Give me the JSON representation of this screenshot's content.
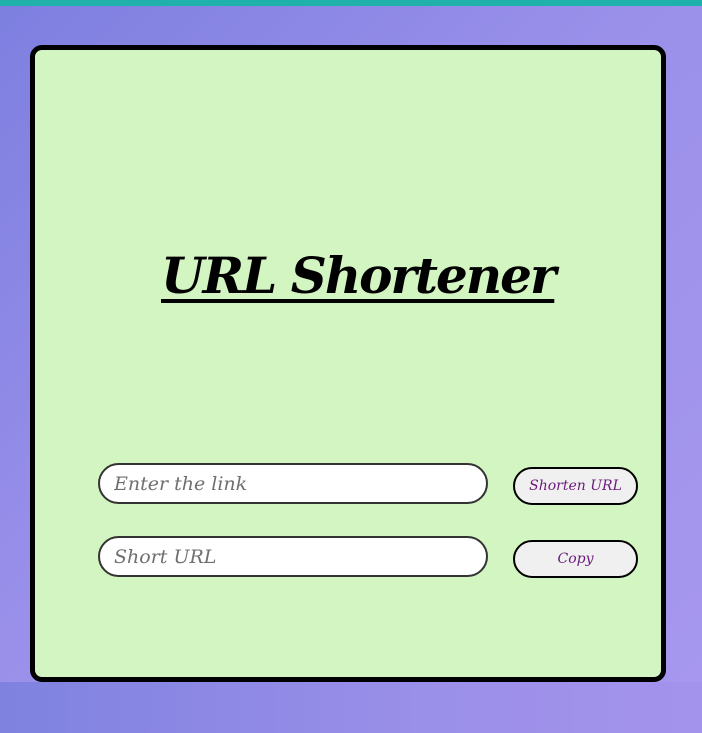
{
  "app": {
    "title": "URL Shortener"
  },
  "form": {
    "link_input": {
      "placeholder": "Enter the link",
      "value": ""
    },
    "short_input": {
      "placeholder": "Short URL",
      "value": ""
    },
    "shorten_button_label": "Shorten URL",
    "copy_button_label": "Copy"
  },
  "colors": {
    "top_strip": "#20b2aa",
    "card_background": "#d3f5c2",
    "card_border": "#000000",
    "button_text": "#6a1b7a",
    "button_background": "#f0f0f0",
    "page_gradient_start": "#7d7fe0",
    "page_gradient_end": "#a898ee"
  }
}
